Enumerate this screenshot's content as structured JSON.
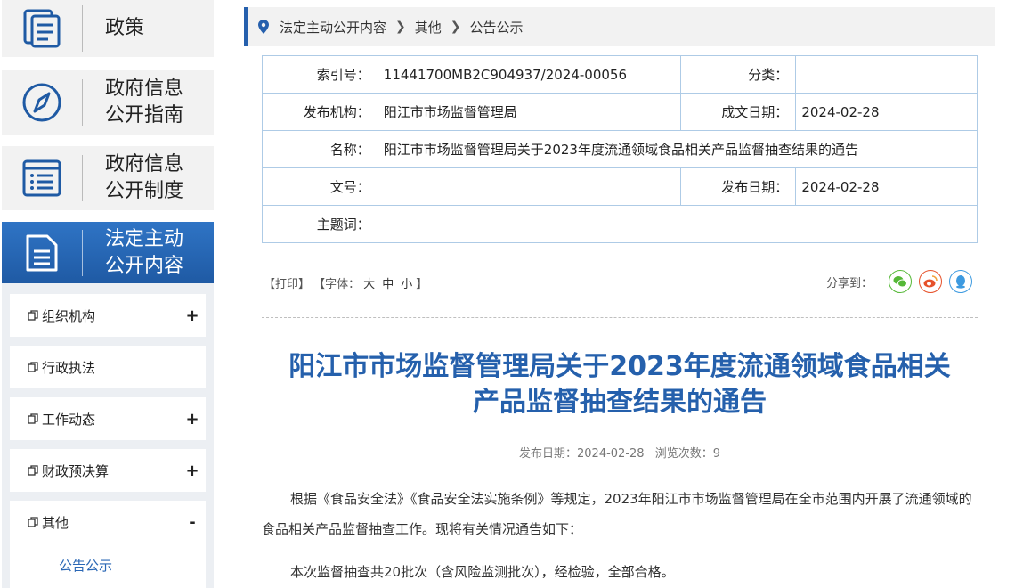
{
  "sidebar": {
    "big_items": [
      {
        "label": "政策",
        "icon": "document-list-icon"
      },
      {
        "label": "政府信息公开指南",
        "icon": "compass-icon"
      },
      {
        "label": "政府信息公开制度",
        "icon": "list-icon"
      },
      {
        "label": "法定主动公开内容",
        "icon": "document-icon"
      }
    ],
    "sub_items": [
      {
        "label": "组织机构",
        "toggle": "+"
      },
      {
        "label": "行政执法",
        "toggle": ""
      },
      {
        "label": "工作动态",
        "toggle": "+"
      },
      {
        "label": "财政预决算",
        "toggle": "+"
      },
      {
        "label": "其他",
        "toggle": "-"
      }
    ],
    "sub_child": "公告公示"
  },
  "breadcrumb": {
    "items": [
      "法定主动公开内容",
      "其他",
      "公告公示"
    ]
  },
  "info": {
    "index_label": "索引号：",
    "index_value": "11441700MB2C904937/2024-00056",
    "category_label": "分类：",
    "category_value": "",
    "publisher_label": "发布机构：",
    "publisher_value": "阳江市市场监督管理局",
    "created_label": "成文日期：",
    "created_value": "2024-02-28",
    "name_label": "名称：",
    "name_value": "阳江市市场监督管理局关于2023年度流通领域食品相关产品监督抽查结果的通告",
    "docno_label": "文号：",
    "docno_value": "",
    "pubdate_label": "发布日期：",
    "pubdate_value": "2024-02-28",
    "keywords_label": "主题词：",
    "keywords_value": ""
  },
  "tools": {
    "print": "【打印】",
    "font_prefix": "【字体：",
    "large": "大",
    "medium": "中",
    "small": "小",
    "font_suffix": "】",
    "share_label": "分享到：",
    "share_colors": {
      "wechat": "#55b837",
      "weibo": "#e6512a",
      "qq": "#3d9ae0"
    }
  },
  "article": {
    "title_line1": "阳江市市场监督管理局关于2023年度流通领域食品相关",
    "title_line2": "产品监督抽查结果的通告",
    "date_text": "发布日期：2024-02-28",
    "views_text": "浏览次数：9",
    "para1": "根据《食品安全法》《食品安全法实施条例》等规定，2023年阳江市市场监督管理局在全市范围内开展了流通领域的食品相关产品监督抽查工作。现将有关情况通告如下：",
    "para2": "本次监督抽查共20批次（含风险监测批次），经检验，全部合格。"
  }
}
